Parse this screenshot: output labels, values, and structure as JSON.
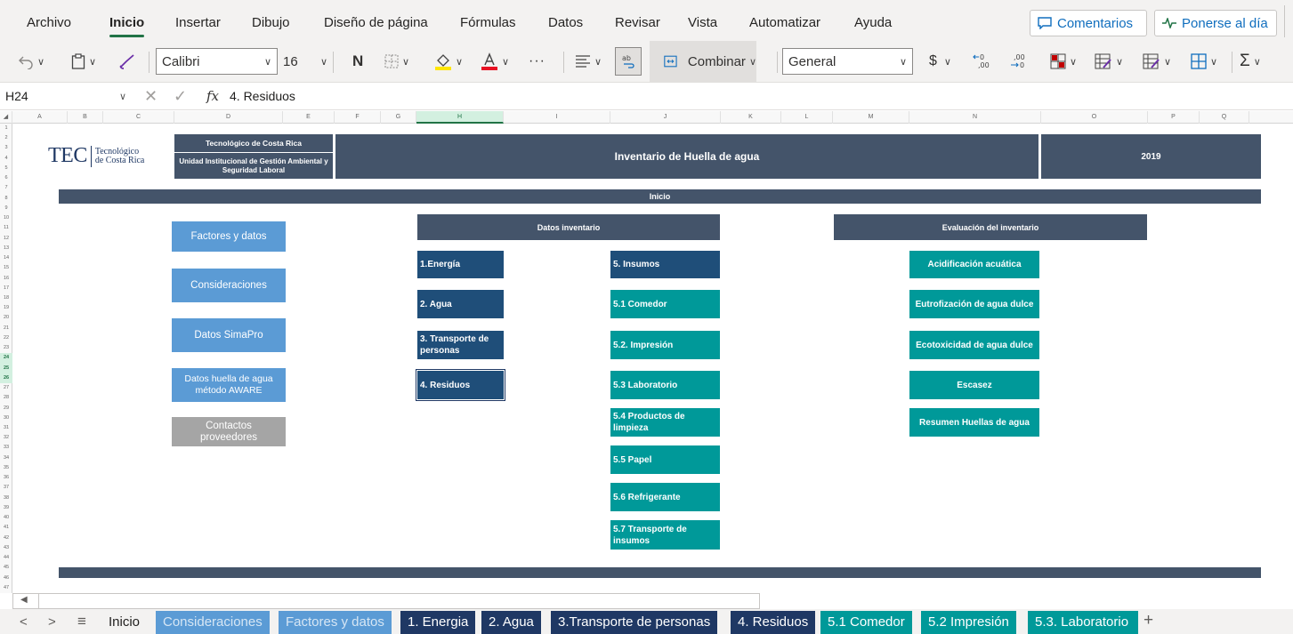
{
  "ribbon": {
    "tabs": [
      "Archivo",
      "Inicio",
      "Insertar",
      "Dibujo",
      "Diseño de página",
      "Fórmulas",
      "Datos",
      "Revisar",
      "Vista",
      "Automatizar",
      "Ayuda"
    ],
    "active_tab": "Inicio",
    "comments_label": "Comentarios",
    "catchup_label": "Ponerse al día"
  },
  "toolbar": {
    "font_name": "Calibri",
    "font_size": "16",
    "bold_label": "N",
    "merge_label": "Combinar",
    "number_format": "General",
    "more_label": "···",
    "currency_label": "$",
    "sum_label": "Σ"
  },
  "formula_bar": {
    "cell_ref": "H24",
    "fx_label": "fx",
    "content": "4. Residuos"
  },
  "grid": {
    "columns": [
      "A",
      "B",
      "C",
      "D",
      "E",
      "F",
      "G",
      "H",
      "I",
      "J",
      "K",
      "L",
      "M",
      "N",
      "O",
      "P",
      "Q"
    ],
    "selected_column": "H",
    "rows": [
      "1",
      "2",
      "3",
      "4",
      "5",
      "6",
      "7",
      "8",
      "9",
      "10",
      "11",
      "12",
      "13",
      "14",
      "15",
      "16",
      "17",
      "18",
      "19",
      "20",
      "21",
      "22",
      "23",
      "24",
      "25",
      "26",
      "27",
      "28",
      "29",
      "30",
      "31",
      "32",
      "33",
      "34",
      "35",
      "36",
      "37",
      "38",
      "39",
      "40",
      "41",
      "42",
      "43",
      "44",
      "45",
      "46",
      "47"
    ],
    "selected_rows": [
      "24",
      "25",
      "26"
    ]
  },
  "sheet": {
    "logo": {
      "mark": "TEC",
      "line1": "Tecnológico",
      "line2": "de Costa Rica"
    },
    "header_institution": "Tecnológico de Costa Rica",
    "header_unit": "Unidad Institucional de Gestión Ambiental y Seguridad Laboral",
    "title": "Inventario de Huella de agua",
    "year": "2019",
    "section_label": "Inicio",
    "left_buttons": [
      {
        "label": "Factores y datos"
      },
      {
        "label": "Consideraciones"
      },
      {
        "label": "Datos SimaPro"
      },
      {
        "label": "Datos huella de agua método AWARE"
      },
      {
        "label": "Contactos proveedores"
      }
    ],
    "inventory_header": "Datos inventario",
    "inventory_left": [
      {
        "label": "1.Energía"
      },
      {
        "label": "2. Agua"
      },
      {
        "label": "3. Transporte de personas"
      },
      {
        "label": "4. Residuos"
      }
    ],
    "inventory_right": [
      {
        "label": "5. Insumos"
      },
      {
        "label": "5.1 Comedor"
      },
      {
        "label": "5.2. Impresión"
      },
      {
        "label": "5.3 Laboratorio"
      },
      {
        "label": "5.4 Productos de limpieza"
      },
      {
        "label": "5.5 Papel"
      },
      {
        "label": "5.6 Refrigerante"
      },
      {
        "label": "5.7 Transporte de insumos"
      }
    ],
    "evaluation_header": "Evaluación del inventario",
    "evaluation_items": [
      {
        "label": "Acidificación acuática"
      },
      {
        "label": "Eutrofización de agua dulce"
      },
      {
        "label": "Ecotoxicidad de agua dulce"
      },
      {
        "label": "Escasez"
      },
      {
        "label": "Resumen Huellas de agua"
      }
    ]
  },
  "sheet_tabs": [
    {
      "label": "Inicio",
      "style": "plain"
    },
    {
      "label": "Consideraciones",
      "style": "light"
    },
    {
      "label": "Factores y datos",
      "style": "light"
    },
    {
      "label": "1. Energia",
      "style": "dark"
    },
    {
      "label": "2. Agua",
      "style": "dark"
    },
    {
      "label": "3.Transporte de personas",
      "style": "dark"
    },
    {
      "label": "4. Residuos",
      "style": "dark"
    },
    {
      "label": "5.1 Comedor",
      "style": "teal"
    },
    {
      "label": "5.2 Impresión",
      "style": "teal"
    },
    {
      "label": "5.3. Laboratorio",
      "style": "teal"
    }
  ],
  "colors": {
    "accent_green": "#217346",
    "header_navy": "#44546a",
    "button_blue": "#5b9bd5",
    "button_gray": "#a5a5a5",
    "dark_navy": "#1f4e79",
    "teal": "#009999"
  }
}
